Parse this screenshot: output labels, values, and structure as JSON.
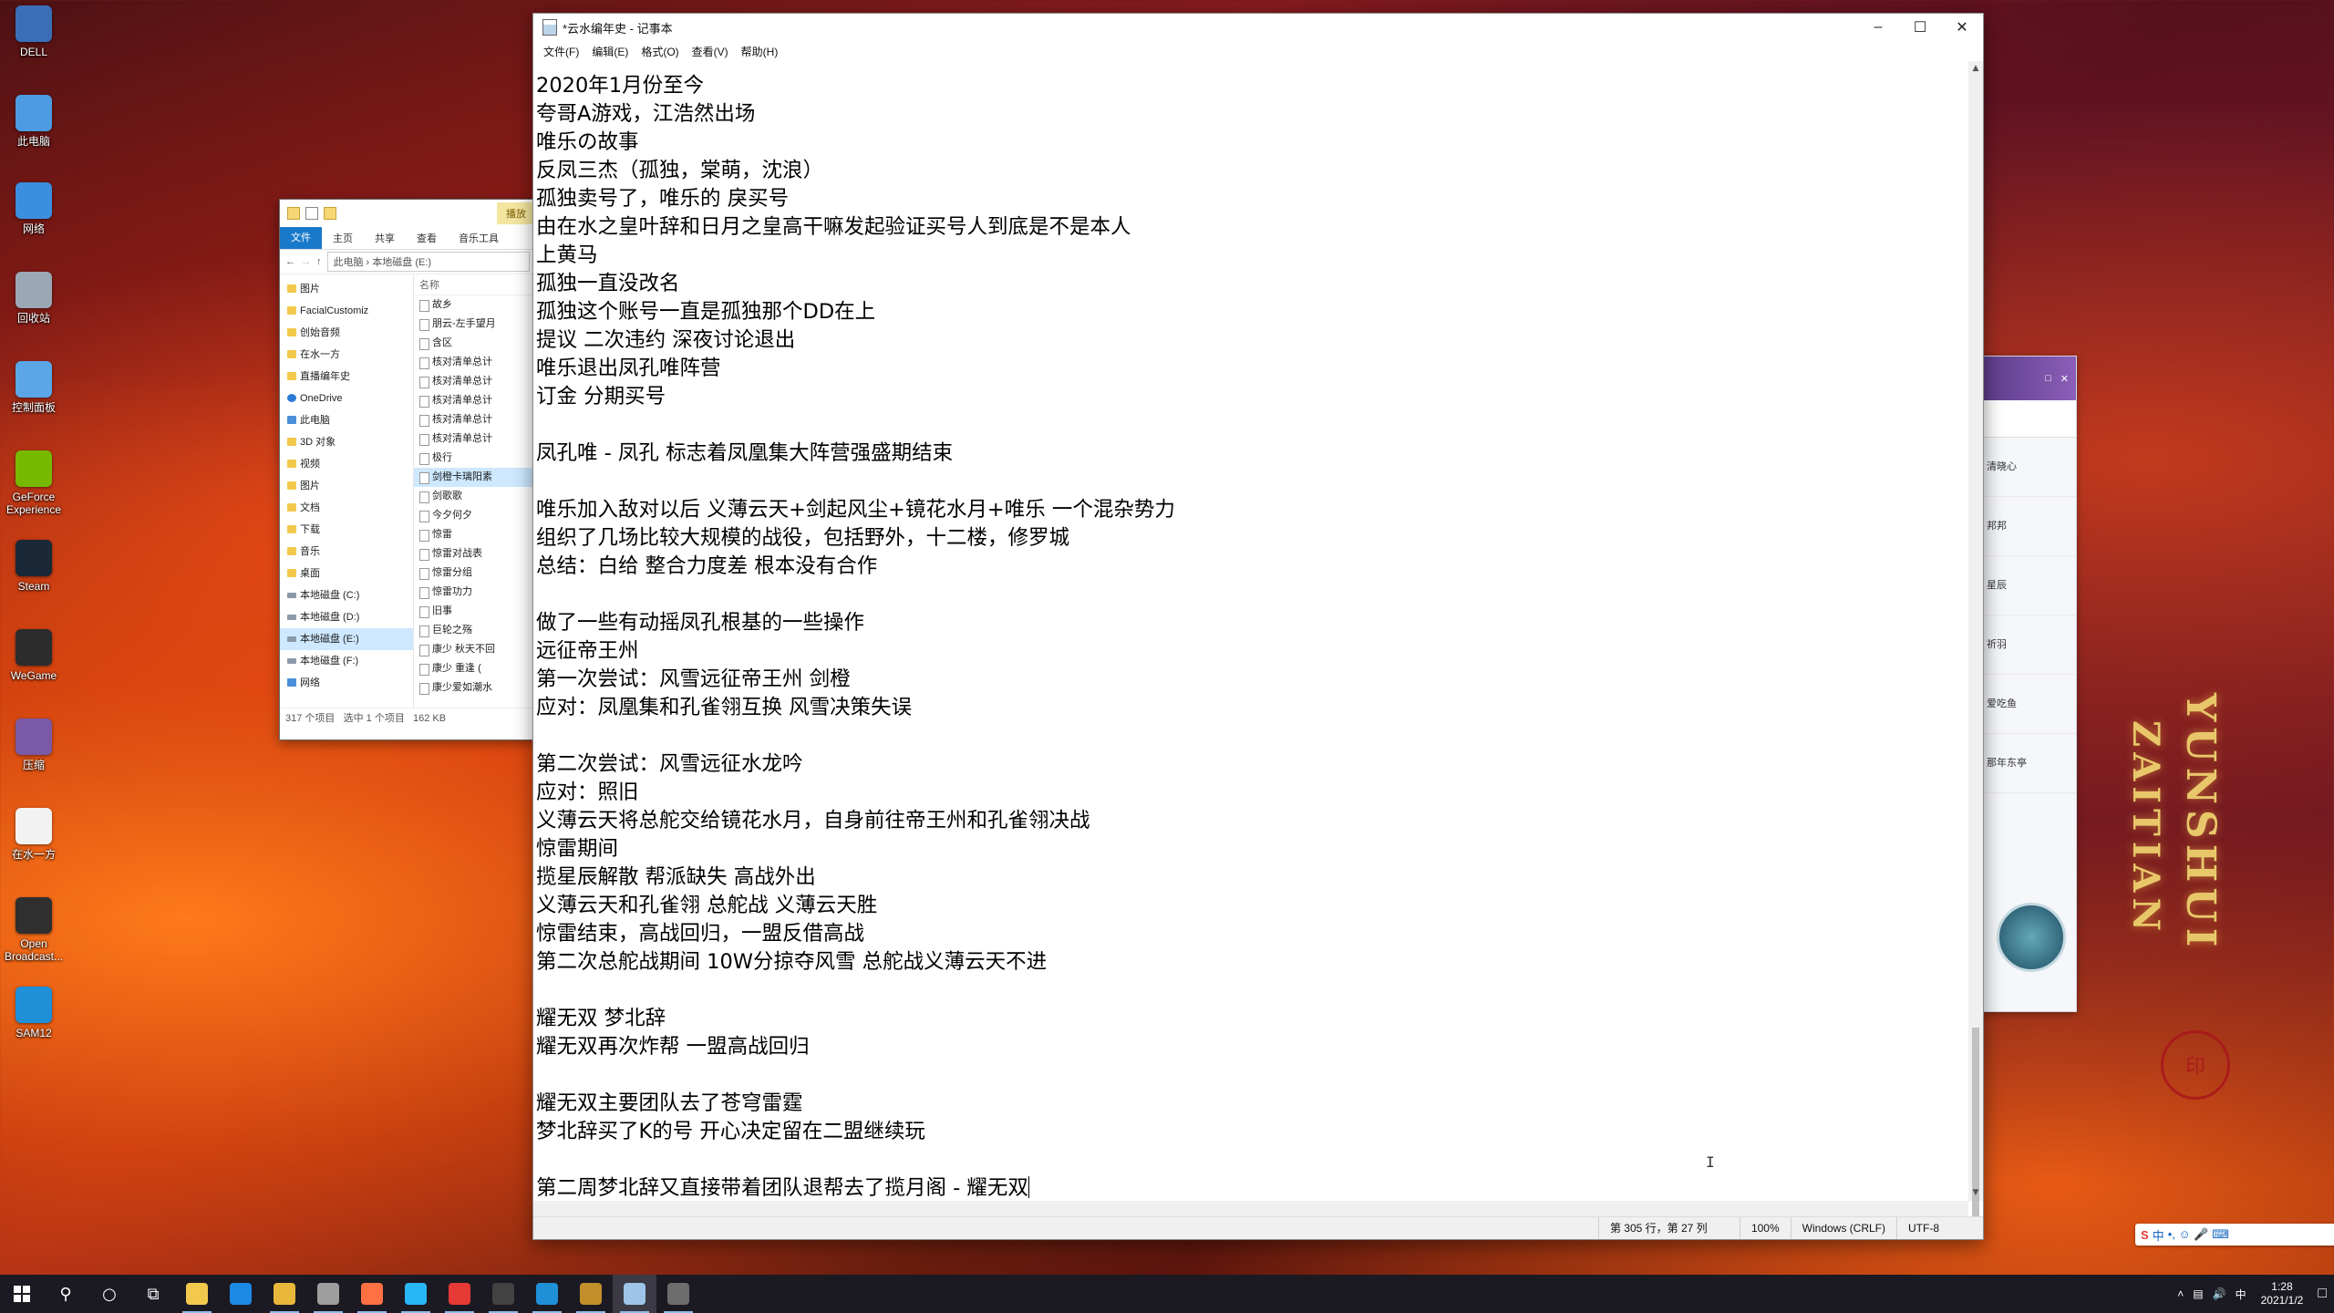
{
  "desktop": {
    "icons": [
      {
        "label": "DELL",
        "color": "#3a6fb8"
      },
      {
        "label": "此电脑",
        "color": "#4d9be0"
      },
      {
        "label": "网络",
        "color": "#3c8ede"
      },
      {
        "label": "回收站",
        "color": "#9aa7b5"
      },
      {
        "label": "控制面板",
        "color": "#5aa6e6"
      },
      {
        "label": "GeForce Experience",
        "color": "#76b900"
      },
      {
        "label": "Steam",
        "color": "#1b2838"
      },
      {
        "label": "WeGame",
        "color": "#2c2c2c"
      },
      {
        "label": "压缩",
        "color": "#7a5aa6"
      },
      {
        "label": "在水一方",
        "color": "#f2f2f2"
      },
      {
        "label": "Open Broadcast...",
        "color": "#2f2f2f"
      },
      {
        "label": "SAM12",
        "color": "#1f8fd8"
      }
    ],
    "art": {
      "vertical_title_1": "YUNSHUI",
      "vertical_title_2": "ZAITIAN",
      "seal": "印"
    }
  },
  "explorer": {
    "play_tab": "播放",
    "ribbon": [
      "文件",
      "主页",
      "共享",
      "查看",
      "音乐工具"
    ],
    "address": [
      "此电脑",
      "本地磁盘 (E:)"
    ],
    "nav": [
      {
        "label": "图片",
        "kind": "folder"
      },
      {
        "label": "FacialCustomiz",
        "kind": "folder"
      },
      {
        "label": "创始音频",
        "kind": "folder"
      },
      {
        "label": "在水一方",
        "kind": "folder"
      },
      {
        "label": "直播编年史",
        "kind": "folder"
      },
      {
        "label": "OneDrive",
        "kind": "cloud"
      },
      {
        "label": "此电脑",
        "kind": "pc"
      },
      {
        "label": "3D 对象",
        "kind": "folder"
      },
      {
        "label": "视频",
        "kind": "folder"
      },
      {
        "label": "图片",
        "kind": "folder"
      },
      {
        "label": "文档",
        "kind": "folder"
      },
      {
        "label": "下载",
        "kind": "folder"
      },
      {
        "label": "音乐",
        "kind": "folder"
      },
      {
        "label": "桌面",
        "kind": "folder"
      },
      {
        "label": "本地磁盘 (C:)",
        "kind": "drive"
      },
      {
        "label": "本地磁盘 (D:)",
        "kind": "drive"
      },
      {
        "label": "本地磁盘 (E:)",
        "kind": "drive",
        "selected": true
      },
      {
        "label": "本地磁盘 (F:)",
        "kind": "drive"
      },
      {
        "label": "网络",
        "kind": "pc"
      }
    ],
    "files_header": "名称",
    "files": [
      "故乡",
      "朋云-左手望月",
      "含区",
      "核对清单总计",
      "核对清单总计",
      "核对清单总计",
      "核对清单总计",
      "核对清单总计",
      "极行",
      "剑橙卡璃阳素",
      "剑歌歌",
      "今夕何夕",
      "惊雷",
      "惊雷对战表",
      "惊雷分组",
      "惊雷功力",
      "旧事",
      "巨轮之殇",
      "康少 秋天不回",
      "康少 重逢 (",
      "康少爱如潮水"
    ],
    "selected_file_index": 9,
    "status": {
      "count": "317 个项目",
      "selected": "选中 1 个项目",
      "size": "162 KB"
    }
  },
  "notepad": {
    "title": "*云水编年史 - 记事本",
    "menu": [
      "文件(F)",
      "编辑(E)",
      "格式(O)",
      "查看(V)",
      "帮助(H)"
    ],
    "lines": [
      "2020年1月份至今",
      "夸哥A游戏，江浩然出场",
      "唯乐の故事",
      "反凤三杰（孤独，棠萌，沈浪）",
      "孤独卖号了，唯乐的 戾买号",
      "由在水之皇叶辞和日月之皇高干嘛发起验证买号人到底是不是本人",
      "上黄马",
      "孤独一直没改名",
      "孤独这个账号一直是孤独那个DD在上",
      "提议 二次违约 深夜讨论退出",
      "唯乐退出凤孔唯阵营",
      "订金 分期买号",
      "",
      "凤孔唯 - 凤孔 标志着凤凰集大阵营强盛期结束",
      "",
      "唯乐加入敌对以后 义薄云天+剑起风尘+镜花水月+唯乐 一个混杂势力",
      "组织了几场比较大规模的战役，包括野外，十二楼，修罗城",
      "总结：白给 整合力度差 根本没有合作",
      "",
      "做了一些有动摇凤孔根基的一些操作",
      "远征帝王州",
      "第一次尝试：风雪远征帝王州 剑橙",
      "应对：凤凰集和孔雀翎互换 风雪决策失误",
      "",
      "第二次尝试：风雪远征水龙吟",
      "应对：照旧",
      "义薄云天将总舵交给镜花水月，自身前往帝王州和孔雀翎决战",
      "惊雷期间",
      "揽星辰解散 帮派缺失 高战外出",
      "义薄云天和孔雀翎 总舵战 义薄云天胜",
      "惊雷结束，高战回归，一盟反借高战",
      "第二次总舵战期间 10W分掠夺风雪 总舵战义薄云天不进",
      "",
      "耀无双 梦北辞",
      "耀无双再次炸帮 一盟高战回归",
      "",
      "耀无双主要团队去了苍穹雷霆",
      "梦北辞买了K的号 开心决定留在二盟继续玩",
      "",
      "第二周梦北辞又直接带着团队退帮去了揽月阁 - 耀无双"
    ],
    "status": {
      "position": "第 305 行，第 27 列",
      "zoom": "100%",
      "line_ending": "Windows (CRLF)",
      "encoding": "UTF-8"
    }
  },
  "qq_panel": {
    "items": [
      "清晓心",
      "邦邦",
      "星辰",
      "祈羽",
      "爱吃鱼",
      "那年东亭"
    ]
  },
  "ime": {
    "label": "中",
    "extra": "•, ☺ 🎤 ⌨"
  },
  "taskbar": {
    "apps": [
      {
        "name": "file-explorer",
        "color": "#f2c94c",
        "open": true
      },
      {
        "name": "edge",
        "color": "#1e88e5",
        "open": false
      },
      {
        "name": "explorer-2",
        "color": "#e9b73a",
        "open": true
      },
      {
        "name": "chrome",
        "color": "#9e9e9e",
        "open": true
      },
      {
        "name": "app-orange",
        "color": "#ff7043",
        "open": true
      },
      {
        "name": "qq-browser",
        "color": "#29b6f6",
        "open": true
      },
      {
        "name": "netease-music",
        "color": "#e53935",
        "open": true
      },
      {
        "name": "obs",
        "color": "#424242",
        "open": true
      },
      {
        "name": "sam12",
        "color": "#1f8fd8",
        "open": true
      },
      {
        "name": "winrar",
        "color": "#c28f2a",
        "open": true
      },
      {
        "name": "notepad",
        "color": "#9ec5e8",
        "open": true,
        "active": true
      },
      {
        "name": "app-disc",
        "color": "#6d6d6d",
        "open": true
      }
    ],
    "tray": {
      "ime": "中",
      "time": "1:28",
      "date": "2021/1/2"
    }
  }
}
